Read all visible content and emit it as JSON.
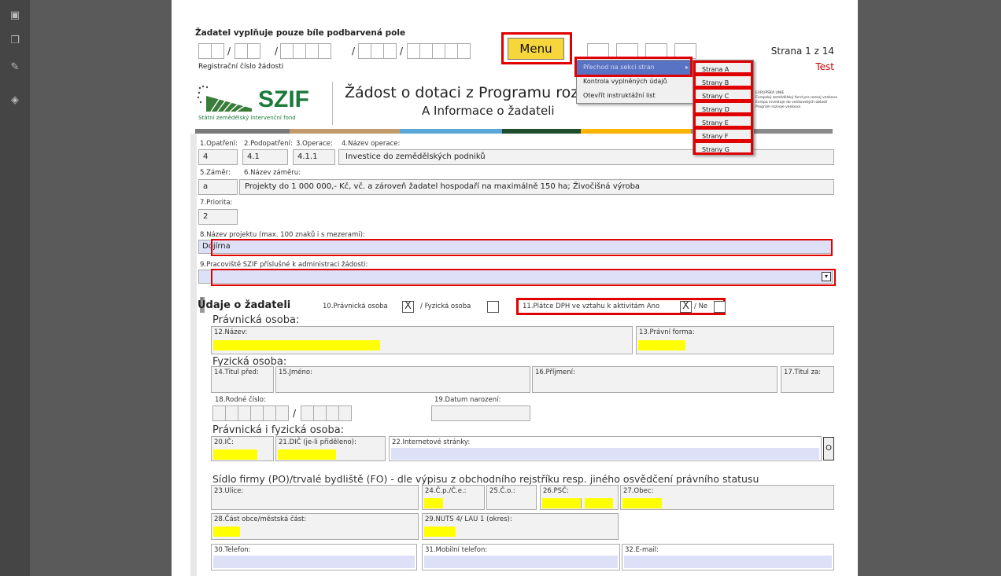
{
  "header": {
    "instruction": "Žadatel vyplňuje pouze bíle podbarvená pole",
    "reg_label": "Registrační číslo žádosti",
    "strana": "Strana 1 z 14",
    "test": "Test",
    "menu": "Menu",
    "logo_text": "SZIF",
    "logo_sub": "Státní zemědělský intervenční fond",
    "title": "Žádost o dotaci z Programu rozvoje venkova",
    "subtitle": "A Informace o žadateli",
    "eu_text": "EVROPSKÁ UNIE\nEvropský zemědělský fond pro rozvoj venkova\nEvropa investuje do venkovských oblastí\nProgram rozvoje venkova",
    "slash": "/"
  },
  "menu": {
    "items": [
      "Přechod na sekci stran",
      "Kontrola vyplněných údajů",
      "Otevřít instruktážní list"
    ],
    "arrow": "▸",
    "strany": [
      "Strana A",
      "Strany B",
      "Strany C",
      "Strany D",
      "Strany E",
      "Strany F",
      "Strany G"
    ]
  },
  "fields": {
    "f1_label": "1.Opatření:",
    "f1_val": "4",
    "f2_label": "2.Podopatření:",
    "f2_val": "4.1",
    "f3_label": "3.Operace:",
    "f3_val": "4.1.1",
    "f4_label": "4.Název operace:",
    "f4_val": "Investice do zemědělských podniků",
    "f5_label": "5.Záměr:",
    "f5_val": "a",
    "f6_label": "6.Název záměru:",
    "f6_val": "Projekty do 1 000 000,- Kč, vč. a zároveň žadatel hospodaří na maximálně 150 ha; Živočišná výroba",
    "f7_label": "7.Priorita:",
    "f7_val": "2",
    "f8_label": "8.Název projektu (max. 100 znaků i s mezerami):",
    "f8_val": "Dojírna",
    "f9_label": "9.Pracoviště SZIF příslušné k administraci žádosti:",
    "f9_val": ""
  },
  "zadatel": {
    "title": "Údaje o žadateli",
    "f10_label": "10.Právnická osoba",
    "f10_fo": "/ Fyzická osoba",
    "f11_label": "11.Plátce DPH ve vztahu k aktivitám  Ano",
    "f11_ne": "/  Ne",
    "checked": "X",
    "po_title": "Právnická osoba:",
    "f12": "12.Název:",
    "f13": "13.Právní forma:",
    "fo_title": "Fyzická osoba:",
    "f14": "14.Titul před:",
    "f15": "15.Jméno:",
    "f16": "16.Příjmení:",
    "f17": "17.Titul za:",
    "f18": "18.Rodné číslo:",
    "f19": "19.Datum narození:",
    "pf_title": "Právnická i fyzická osoba:",
    "f20": "20.IČ:",
    "f21": "21.DIČ (je-li přiděleno):",
    "f22": "22.Internetové stránky:",
    "btn_o": "O",
    "sidlo_title": "Sídlo firmy (PO)/trvalé bydliště (FO) - dle výpisu z obchodního rejstříku resp. jiného osvědčení právního statusu",
    "f23": "23.Ulice:",
    "f24": "24.Č.p./Č.e.:",
    "f25": "25.Č.o.:",
    "f26": "26.PSČ:",
    "f27": "27.Obec:",
    "f28": "28.Část obce/městská část:",
    "f29": "29.NUTS 4/ LAU 1 (okres):",
    "f30": "30.Telefon:",
    "f31": "31.Mobilní telefon:",
    "f32": "32.E-mail:"
  },
  "colors": {
    "red_outline": "#e00000",
    "menu_yellow": "#f7d63c",
    "field_yellow": "#ffff00",
    "field_lavender": "#dde0f7",
    "menu_highlight": "#5872c4"
  }
}
